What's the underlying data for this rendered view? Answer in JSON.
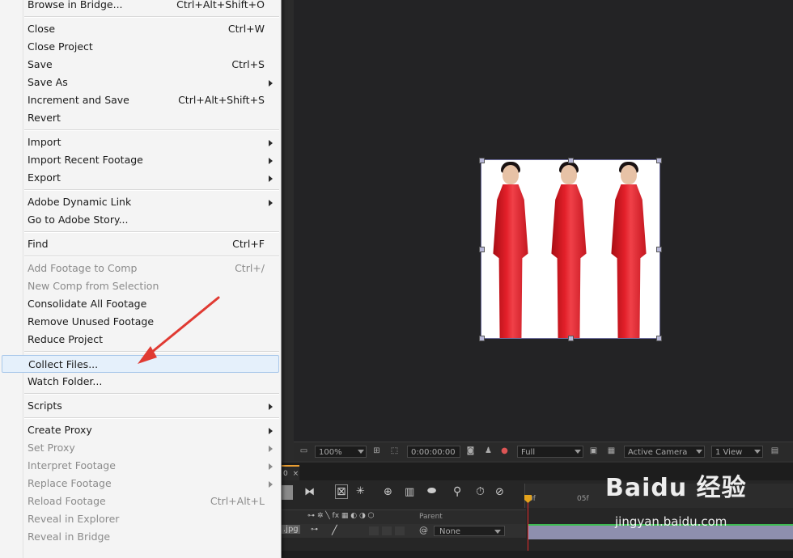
{
  "menu": {
    "items": [
      {
        "label": "Browse in Bridge...",
        "shortcut": "Ctrl+Alt+Shift+O",
        "submenu": false,
        "disabled": false
      },
      {
        "sep": true
      },
      {
        "label": "Close",
        "shortcut": "Ctrl+W",
        "submenu": false,
        "disabled": false
      },
      {
        "label": "Close Project",
        "shortcut": "",
        "submenu": false,
        "disabled": false
      },
      {
        "label": "Save",
        "shortcut": "Ctrl+S",
        "submenu": false,
        "disabled": false
      },
      {
        "label": "Save As",
        "shortcut": "",
        "submenu": true,
        "disabled": false
      },
      {
        "label": "Increment and Save",
        "shortcut": "Ctrl+Alt+Shift+S",
        "submenu": false,
        "disabled": false
      },
      {
        "label": "Revert",
        "shortcut": "",
        "submenu": false,
        "disabled": false
      },
      {
        "sep": true
      },
      {
        "label": "Import",
        "shortcut": "",
        "submenu": true,
        "disabled": false
      },
      {
        "label": "Import Recent Footage",
        "shortcut": "",
        "submenu": true,
        "disabled": false
      },
      {
        "label": "Export",
        "shortcut": "",
        "submenu": true,
        "disabled": false
      },
      {
        "sep": true
      },
      {
        "label": "Adobe Dynamic Link",
        "shortcut": "",
        "submenu": true,
        "disabled": false
      },
      {
        "label": "Go to Adobe Story...",
        "shortcut": "",
        "submenu": false,
        "disabled": false
      },
      {
        "sep": true
      },
      {
        "label": "Find",
        "shortcut": "Ctrl+F",
        "submenu": false,
        "disabled": false
      },
      {
        "sep": true
      },
      {
        "label": "Add Footage to Comp",
        "shortcut": "Ctrl+/",
        "submenu": false,
        "disabled": true
      },
      {
        "label": "New Comp from Selection",
        "shortcut": "",
        "submenu": false,
        "disabled": true
      },
      {
        "label": "Consolidate All Footage",
        "shortcut": "",
        "submenu": false,
        "disabled": false
      },
      {
        "label": "Remove Unused Footage",
        "shortcut": "",
        "submenu": false,
        "disabled": false
      },
      {
        "label": "Reduce Project",
        "shortcut": "",
        "submenu": false,
        "disabled": false
      },
      {
        "sep": true
      },
      {
        "label": "Collect Files...",
        "shortcut": "",
        "submenu": false,
        "disabled": false,
        "highlighted": true
      },
      {
        "label": "Watch Folder...",
        "shortcut": "",
        "submenu": false,
        "disabled": false
      },
      {
        "sep": true
      },
      {
        "label": "Scripts",
        "shortcut": "",
        "submenu": true,
        "disabled": false
      },
      {
        "sep": true
      },
      {
        "label": "Create Proxy",
        "shortcut": "",
        "submenu": true,
        "disabled": false
      },
      {
        "label": "Set Proxy",
        "shortcut": "",
        "submenu": true,
        "disabled": true
      },
      {
        "label": "Interpret Footage",
        "shortcut": "",
        "submenu": true,
        "disabled": true
      },
      {
        "label": "Replace Footage",
        "shortcut": "",
        "submenu": true,
        "disabled": true
      },
      {
        "label": "Reload Footage",
        "shortcut": "Ctrl+Alt+L",
        "submenu": false,
        "disabled": true
      },
      {
        "label": "Reveal in Explorer",
        "shortcut": "",
        "submenu": false,
        "disabled": true
      },
      {
        "label": "Reveal in Bridge",
        "shortcut": "",
        "submenu": false,
        "disabled": true
      }
    ]
  },
  "viewer": {
    "zoom": "100%",
    "timecode": "0:00:00:00",
    "resolution": "Full",
    "camera": "Active Camera",
    "views": "1 View"
  },
  "timeline": {
    "tab_label": "0",
    "ruler_labels": [
      "0f",
      "05f"
    ],
    "parent_header": "Parent",
    "layer_name": ".jpg",
    "parent_value": "None"
  },
  "watermark": {
    "brand": "Baidu 经验",
    "url": "jingyan.baidu.com"
  },
  "colors": {
    "menu_bg": "#f4f4f4",
    "highlight": "#e5f0fb",
    "cti": "#e32a2a",
    "layer_bar": "#8e8fae",
    "annotation_arrow": "#e03a32"
  }
}
